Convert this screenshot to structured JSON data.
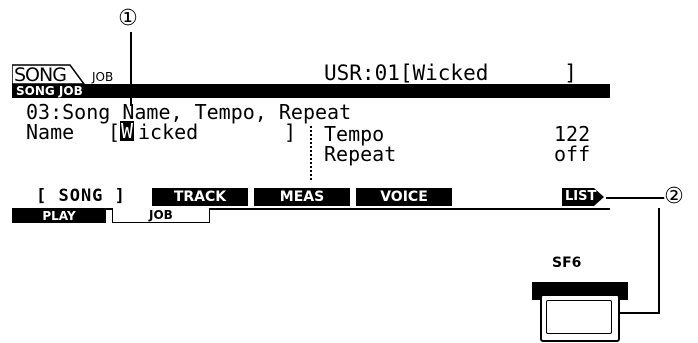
{
  "header": {
    "mode": "SONG",
    "sub_mode": "JOB",
    "song_ref": "USR:01[Wicked      ]"
  },
  "title_bar": {
    "label": "SONG JOB"
  },
  "job": {
    "heading": "03:Song Name, Tempo, Repeat",
    "name_label": "Name",
    "name_open_bracket": "[",
    "name_cursor_char": "W",
    "name_value_rest": "icked",
    "name_close_bracket": "]",
    "tempo_label": "Tempo",
    "tempo_value": "122",
    "repeat_label": "Repeat",
    "repeat_value": "off"
  },
  "soft_tabs": [
    {
      "label": "[ SONG ]",
      "active": true
    },
    {
      "label": "TRACK",
      "active": false
    },
    {
      "label": "MEAS",
      "active": false
    },
    {
      "label": "VOICE",
      "active": false
    }
  ],
  "list_button": {
    "label": "LIST"
  },
  "bottom_tabs": [
    {
      "label": "PLAY",
      "active": false
    },
    {
      "label": "JOB",
      "active": true
    }
  ],
  "callouts": {
    "one": "①",
    "two": "②"
  },
  "hardware": {
    "sf6_label": "SF6"
  }
}
